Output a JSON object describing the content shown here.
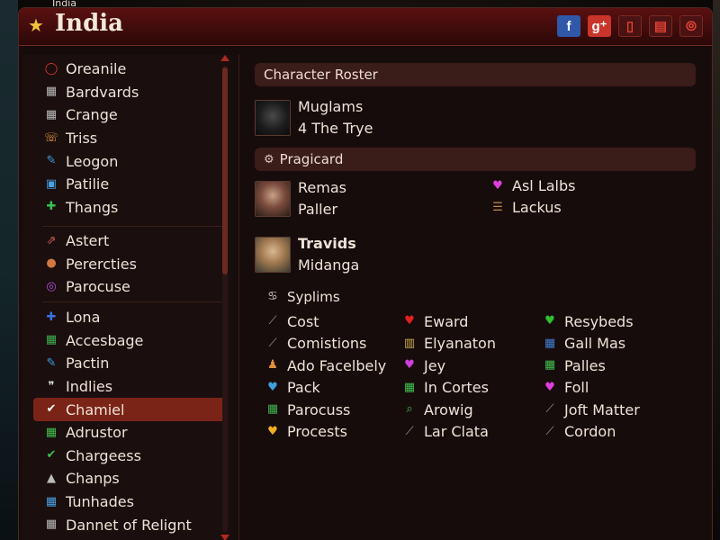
{
  "window": {
    "caption": "India",
    "title": "India"
  },
  "titlebar_icons": [
    {
      "name": "facebook-icon",
      "glyph": "f"
    },
    {
      "name": "google-plus-icon",
      "glyph": "g⁺"
    },
    {
      "name": "phone-icon",
      "glyph": "▯"
    },
    {
      "name": "chat-icon",
      "glyph": "▤"
    },
    {
      "name": "link-icon",
      "glyph": "⦾"
    }
  ],
  "sidebar": {
    "groups": [
      [
        {
          "label": "Oreanile",
          "icon": "ring-icon",
          "glyph": "◯",
          "color": "#e03a2a"
        },
        {
          "label": "Bardvards",
          "icon": "image-icon",
          "glyph": "▦",
          "color": "#bbbbbb"
        },
        {
          "label": "Crange",
          "icon": "image-icon",
          "glyph": "▦",
          "color": "#bbbbbb"
        },
        {
          "label": "Triss",
          "icon": "phone-icon",
          "glyph": "☏",
          "color": "#f0a040"
        },
        {
          "label": "Leogon",
          "icon": "pen-icon",
          "glyph": "✎",
          "color": "#3aa0e0"
        },
        {
          "label": "Patilie",
          "icon": "map-icon",
          "glyph": "▣",
          "color": "#4aa0e0"
        },
        {
          "label": "Thangs",
          "icon": "plus-icon",
          "glyph": "✚",
          "color": "#3ac050"
        }
      ],
      [
        {
          "label": "Astert",
          "icon": "arrows-icon",
          "glyph": "⇗",
          "color": "#d06050"
        },
        {
          "label": "Perercties",
          "icon": "orb-icon",
          "glyph": "●",
          "color": "#d07840"
        },
        {
          "label": "Parocuse",
          "icon": "badge-icon",
          "glyph": "◎",
          "color": "#b050e0"
        }
      ],
      [
        {
          "label": "Lona",
          "icon": "plus-icon",
          "glyph": "✚",
          "color": "#3a70e0"
        },
        {
          "label": "Accesbage",
          "icon": "grid-icon",
          "glyph": "▦",
          "color": "#40b050"
        },
        {
          "label": "Pactin",
          "icon": "pen-icon",
          "glyph": "✎",
          "color": "#3aa0e0"
        },
        {
          "label": "Indlies",
          "icon": "quote-icon",
          "glyph": "❞",
          "color": "#dddddd"
        },
        {
          "label": "Chamiel",
          "icon": "check-icon",
          "glyph": "✔",
          "color": "#ffffff"
        },
        {
          "label": "Adrustor",
          "icon": "grid-icon",
          "glyph": "▦",
          "color": "#40c050"
        },
        {
          "label": "Chargeess",
          "icon": "check-box-icon",
          "glyph": "✔",
          "color": "#40c050"
        },
        {
          "label": "Chanps",
          "icon": "triangle-icon",
          "glyph": "▲",
          "color": "#bbbbbb"
        },
        {
          "label": "Tunhades",
          "icon": "image-icon",
          "glyph": "▦",
          "color": "#4aa0e0"
        },
        {
          "label": "Dannet of Relignt",
          "icon": "image-icon",
          "glyph": "▦",
          "color": "#bbbbbb"
        }
      ]
    ],
    "active_label": "Chamiel"
  },
  "roster": {
    "header": "Character Roster",
    "card": {
      "line1": "Muglams",
      "line2": "4 The Trye"
    }
  },
  "pragicard": {
    "header": "Pragicard",
    "header_glyph": "⚙",
    "card1": {
      "line1": "Remas",
      "line2": "Paller"
    },
    "side_items": [
      {
        "label": "Asl Lalbs",
        "glyph": "♥",
        "color": "#e040e0"
      },
      {
        "label": "Lackus",
        "glyph": "☰",
        "color": "#c08850"
      }
    ],
    "card2": {
      "line1": "Travids",
      "line2": "Midanga"
    }
  },
  "syplims": {
    "header": "Syplims",
    "header_glyph": "♋",
    "columns": [
      [
        {
          "label": "Cost",
          "glyph": "⟋",
          "color": "#999999"
        },
        {
          "label": "Comistions",
          "glyph": "⟋",
          "color": "#999999"
        },
        {
          "label": "Ado Facelbely",
          "glyph": "♟",
          "color": "#e09040"
        },
        {
          "label": "Pack",
          "glyph": "♥",
          "color": "#40a0e0"
        },
        {
          "label": "Parocuss",
          "glyph": "▦",
          "color": "#40b050"
        },
        {
          "label": "Procests",
          "glyph": "♥",
          "color": "#f0b020"
        }
      ],
      [
        {
          "label": "Eward",
          "glyph": "♥",
          "color": "#e02020"
        },
        {
          "label": "Elyanaton",
          "glyph": "▥",
          "color": "#d0b050"
        },
        {
          "label": "Jey",
          "glyph": "♥",
          "color": "#d040e0"
        },
        {
          "label": "In Cortes",
          "glyph": "▦",
          "color": "#40c050"
        },
        {
          "label": "Arowig",
          "glyph": "⌕",
          "color": "#40c050"
        },
        {
          "label": "Lar Clata",
          "glyph": "⟋",
          "color": "#999999"
        }
      ],
      [
        {
          "label": "Resybeds",
          "glyph": "♥",
          "color": "#30c030"
        },
        {
          "label": "Gall Mas",
          "glyph": "▦",
          "color": "#4080d0"
        },
        {
          "label": "Palles",
          "glyph": "▦",
          "color": "#40c050"
        },
        {
          "label": "Foll",
          "glyph": "♥",
          "color": "#e040e0"
        },
        {
          "label": "Joft Matter",
          "glyph": "⟋",
          "color": "#999999"
        },
        {
          "label": "Cordon",
          "glyph": "⟋",
          "color": "#999999"
        }
      ]
    ]
  }
}
